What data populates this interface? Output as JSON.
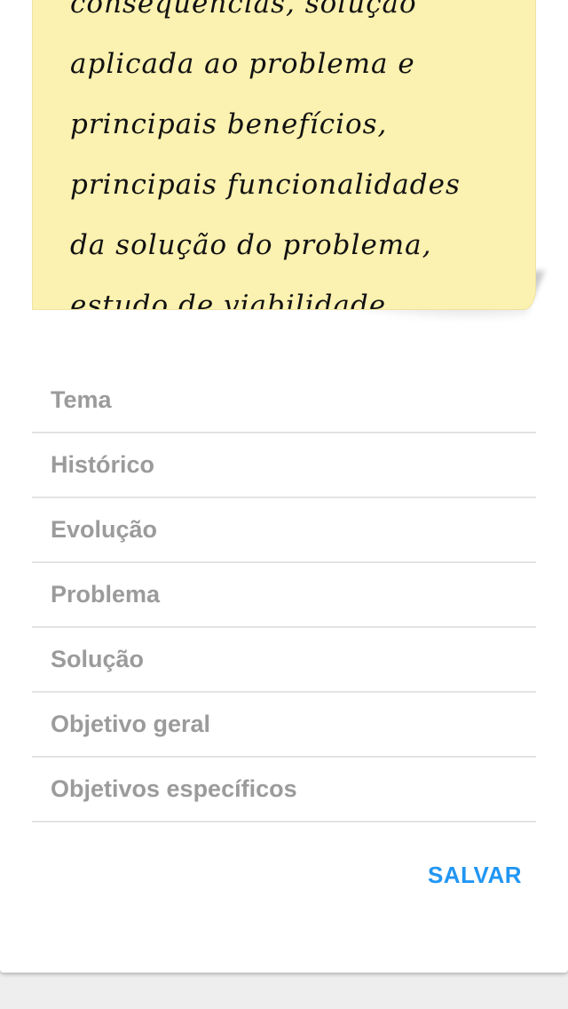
{
  "note": {
    "text": "consequências, solução aplicada ao problema e principais benefícios, principais funcionalidades da solução do problema, estudo de viabilidade."
  },
  "form": {
    "fields": [
      {
        "label": "Tema"
      },
      {
        "label": "Histórico"
      },
      {
        "label": "Evolução"
      },
      {
        "label": "Problema"
      },
      {
        "label": "Solução"
      },
      {
        "label": "Objetivo geral"
      },
      {
        "label": "Objetivos específicos"
      }
    ],
    "save_label": "SALVAR"
  },
  "colors": {
    "note_bg": "#fbf1b0",
    "accent": "#2196f3",
    "field_text": "#9b9b9b",
    "page_bg": "#eeeeee"
  }
}
